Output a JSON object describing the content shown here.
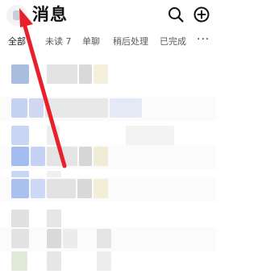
{
  "header": {
    "title": "消息",
    "search_icon": "search-icon",
    "add_icon": "add-circle-icon"
  },
  "tabs": [
    {
      "label": "全部"
    },
    {
      "label": "未读 7"
    },
    {
      "label": "单聊"
    },
    {
      "label": "稍后处理"
    },
    {
      "label": "已完成"
    },
    {
      "label": "···"
    }
  ],
  "annotation": {
    "type": "red-arrow",
    "color": "#e8202a",
    "points_to": "avatar"
  },
  "colors": {
    "blur_blue": "#aec4ef",
    "blur_gray": "#dcdcdc",
    "blur_cream": "#f3efd9"
  }
}
